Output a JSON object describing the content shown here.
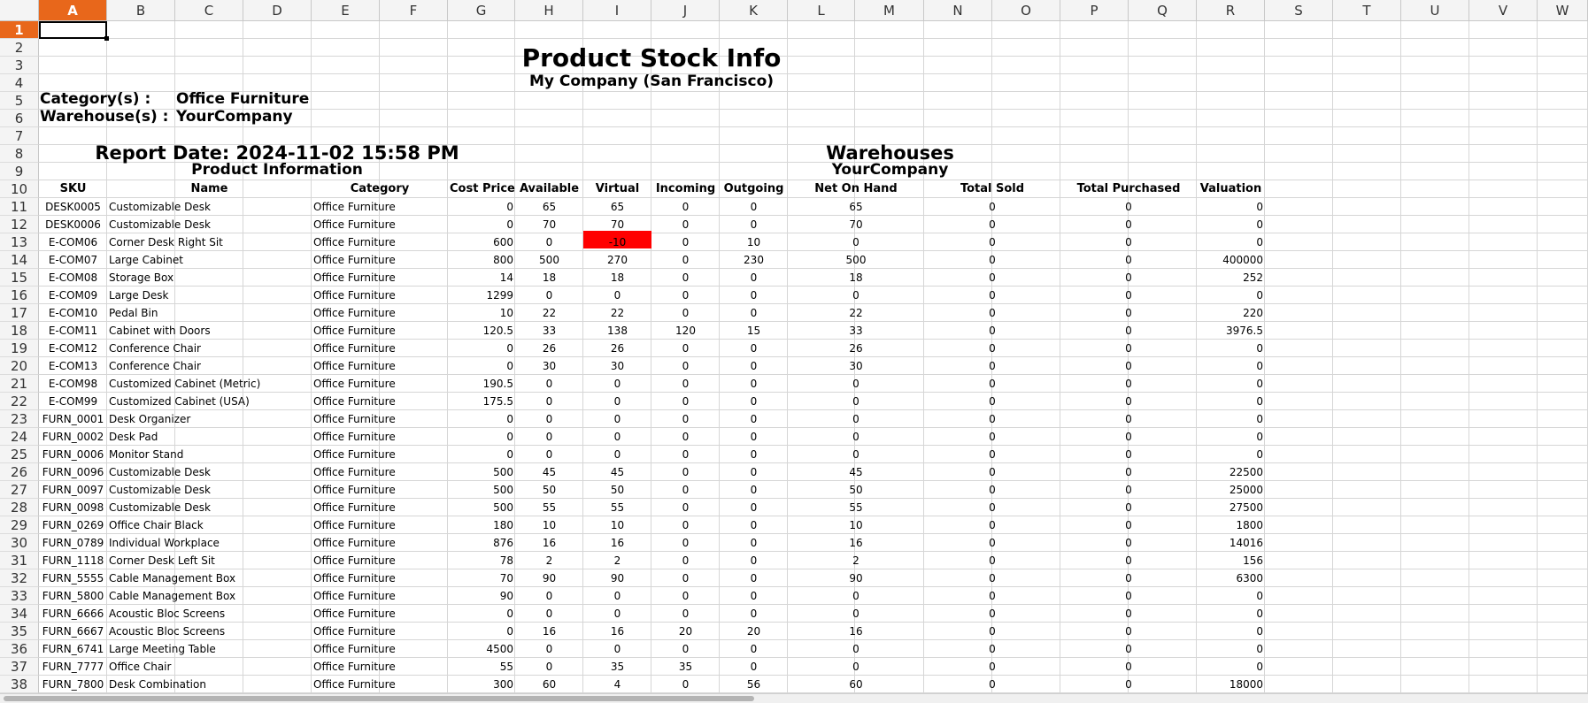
{
  "columns": [
    "A",
    "B",
    "C",
    "D",
    "E",
    "F",
    "G",
    "H",
    "I",
    "J",
    "K",
    "L",
    "M",
    "N",
    "O",
    "P",
    "Q",
    "R",
    "S",
    "T",
    "U",
    "V",
    "W"
  ],
  "rows": [
    1,
    2,
    3,
    4,
    5,
    6,
    7,
    8,
    9,
    10,
    11,
    12,
    13,
    14,
    15,
    16,
    17,
    18,
    19,
    20,
    21,
    22,
    23,
    24,
    25,
    26,
    27,
    28,
    29,
    30,
    31,
    32,
    33,
    34,
    35,
    36,
    37,
    38
  ],
  "selected_cell": {
    "column": "A",
    "row": 1
  },
  "report": {
    "title": "Product Stock Info",
    "company": "My Company (San Francisco)",
    "category_label": "Category(s) :",
    "category_value": "Office Furniture",
    "warehouse_label": "Warehouse(s) :",
    "warehouse_value": "YourCompany",
    "report_date": "Report Date: 2024-11-02 15:58 PM",
    "product_info_header": "Product Information",
    "warehouses_header": "Warehouses",
    "warehouse_name": "YourCompany"
  },
  "table_headers": [
    "SKU",
    "Name",
    "Category",
    "Cost Price",
    "Available",
    "Virtual",
    "Incoming",
    "Outgoing",
    "Net On Hand",
    "Total Sold",
    "Total Purchased",
    "Valuation"
  ],
  "highlight": {
    "row_index": 2,
    "column": "Virtual",
    "color": "#ff0000"
  },
  "table_rows": [
    [
      "DESK0005",
      "Customizable Desk",
      "Office Furniture",
      "0",
      "65",
      "65",
      "0",
      "0",
      "65",
      "0",
      "0",
      "0"
    ],
    [
      "DESK0006",
      "Customizable Desk",
      "Office Furniture",
      "0",
      "70",
      "70",
      "0",
      "0",
      "70",
      "0",
      "0",
      "0"
    ],
    [
      "E-COM06",
      "Corner Desk Right Sit",
      "Office Furniture",
      "600",
      "0",
      "-10",
      "0",
      "10",
      "0",
      "0",
      "0",
      "0"
    ],
    [
      "E-COM07",
      "Large Cabinet",
      "Office Furniture",
      "800",
      "500",
      "270",
      "0",
      "230",
      "500",
      "0",
      "0",
      "400000"
    ],
    [
      "E-COM08",
      "Storage Box",
      "Office Furniture",
      "14",
      "18",
      "18",
      "0",
      "0",
      "18",
      "0",
      "0",
      "252"
    ],
    [
      "E-COM09",
      "Large Desk",
      "Office Furniture",
      "1299",
      "0",
      "0",
      "0",
      "0",
      "0",
      "0",
      "0",
      "0"
    ],
    [
      "E-COM10",
      "Pedal Bin",
      "Office Furniture",
      "10",
      "22",
      "22",
      "0",
      "0",
      "22",
      "0",
      "0",
      "220"
    ],
    [
      "E-COM11",
      "Cabinet with Doors",
      "Office Furniture",
      "120.5",
      "33",
      "138",
      "120",
      "15",
      "33",
      "0",
      "0",
      "3976.5"
    ],
    [
      "E-COM12",
      "Conference Chair",
      "Office Furniture",
      "0",
      "26",
      "26",
      "0",
      "0",
      "26",
      "0",
      "0",
      "0"
    ],
    [
      "E-COM13",
      "Conference Chair",
      "Office Furniture",
      "0",
      "30",
      "30",
      "0",
      "0",
      "30",
      "0",
      "0",
      "0"
    ],
    [
      "E-COM98",
      "Customized Cabinet (Metric)",
      "Office Furniture",
      "190.5",
      "0",
      "0",
      "0",
      "0",
      "0",
      "0",
      "0",
      "0"
    ],
    [
      "E-COM99",
      "Customized Cabinet (USA)",
      "Office Furniture",
      "175.5",
      "0",
      "0",
      "0",
      "0",
      "0",
      "0",
      "0",
      "0"
    ],
    [
      "FURN_0001",
      "Desk Organizer",
      "Office Furniture",
      "0",
      "0",
      "0",
      "0",
      "0",
      "0",
      "0",
      "0",
      "0"
    ],
    [
      "FURN_0002",
      "Desk Pad",
      "Office Furniture",
      "0",
      "0",
      "0",
      "0",
      "0",
      "0",
      "0",
      "0",
      "0"
    ],
    [
      "FURN_0006",
      "Monitor Stand",
      "Office Furniture",
      "0",
      "0",
      "0",
      "0",
      "0",
      "0",
      "0",
      "0",
      "0"
    ],
    [
      "FURN_0096",
      "Customizable Desk",
      "Office Furniture",
      "500",
      "45",
      "45",
      "0",
      "0",
      "45",
      "0",
      "0",
      "22500"
    ],
    [
      "FURN_0097",
      "Customizable Desk",
      "Office Furniture",
      "500",
      "50",
      "50",
      "0",
      "0",
      "50",
      "0",
      "0",
      "25000"
    ],
    [
      "FURN_0098",
      "Customizable Desk",
      "Office Furniture",
      "500",
      "55",
      "55",
      "0",
      "0",
      "55",
      "0",
      "0",
      "27500"
    ],
    [
      "FURN_0269",
      "Office Chair Black",
      "Office Furniture",
      "180",
      "10",
      "10",
      "0",
      "0",
      "10",
      "0",
      "0",
      "1800"
    ],
    [
      "FURN_0789",
      "Individual Workplace",
      "Office Furniture",
      "876",
      "16",
      "16",
      "0",
      "0",
      "16",
      "0",
      "0",
      "14016"
    ],
    [
      "FURN_1118",
      "Corner Desk Left Sit",
      "Office Furniture",
      "78",
      "2",
      "2",
      "0",
      "0",
      "2",
      "0",
      "0",
      "156"
    ],
    [
      "FURN_5555",
      "Cable Management Box",
      "Office Furniture",
      "70",
      "90",
      "90",
      "0",
      "0",
      "90",
      "0",
      "0",
      "6300"
    ],
    [
      "FURN_5800",
      "Cable Management Box",
      "Office Furniture",
      "90",
      "0",
      "0",
      "0",
      "0",
      "0",
      "0",
      "0",
      "0"
    ],
    [
      "FURN_6666",
      "Acoustic Bloc Screens",
      "Office Furniture",
      "0",
      "0",
      "0",
      "0",
      "0",
      "0",
      "0",
      "0",
      "0"
    ],
    [
      "FURN_6667",
      "Acoustic Bloc Screens",
      "Office Furniture",
      "0",
      "16",
      "16",
      "20",
      "20",
      "16",
      "0",
      "0",
      "0"
    ],
    [
      "FURN_6741",
      "Large Meeting Table",
      "Office Furniture",
      "4500",
      "0",
      "0",
      "0",
      "0",
      "0",
      "0",
      "0",
      "0"
    ],
    [
      "FURN_7777",
      "Office Chair",
      "Office Furniture",
      "55",
      "0",
      "35",
      "35",
      "0",
      "0",
      "0",
      "0",
      "0"
    ],
    [
      "FURN_7800",
      "Desk Combination",
      "Office Furniture",
      "300",
      "60",
      "4",
      "0",
      "56",
      "60",
      "0",
      "0",
      "18000"
    ]
  ]
}
